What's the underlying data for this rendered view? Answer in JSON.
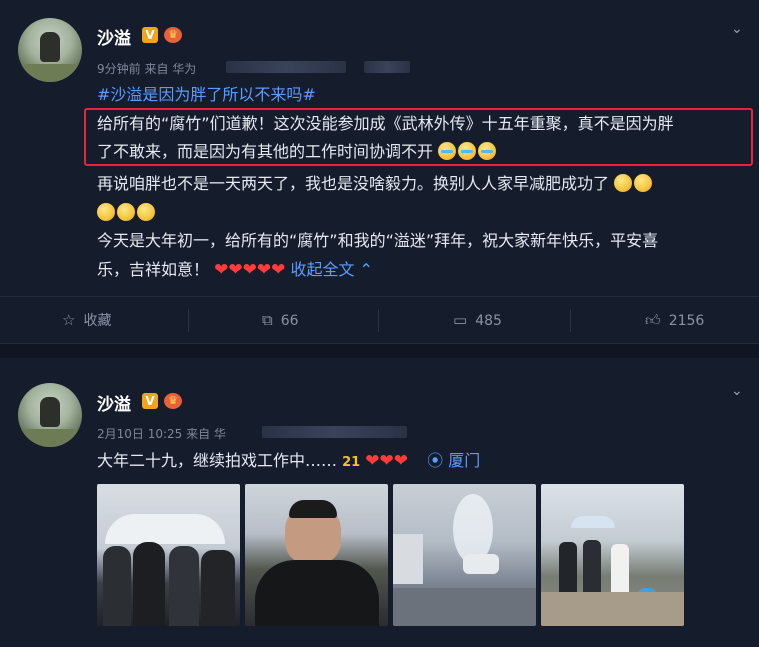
{
  "post1": {
    "author": "沙溢",
    "v_badge": "V",
    "crown_icon": "crown-icon",
    "meta": "9分钟前 来自 华为",
    "hashtag": "#沙溢是因为胖了所以不来吗#",
    "line1": "给所有的“腐竹”们道歉！这次没能参加成《武林外传》十五年重聚，真不是因为胖",
    "line2": "了不敢来，而是因为有其他的工作时间协调不开",
    "line3": "再说咱胖也不是一天两天了，我也是没啥毅力。换别人人家早减肥成功了",
    "line5": "今天是大年初一，给所有的“腐竹”和我的“溢迷”拜年，祝大家新年快乐，平安喜",
    "line6": "乐，吉祥如意！",
    "hearts": "❤❤❤❤❤",
    "collapse": "收起全文",
    "actions": {
      "favorite": "收藏",
      "repost": "66",
      "comment": "485",
      "like": "2156"
    }
  },
  "post2": {
    "author": "沙溢",
    "v_badge": "V",
    "meta": "2月10日 10:25 来自 华",
    "text": "大年二十九，继续拍戏工作中……",
    "hearts": "❤❤❤",
    "location": "厦门"
  }
}
